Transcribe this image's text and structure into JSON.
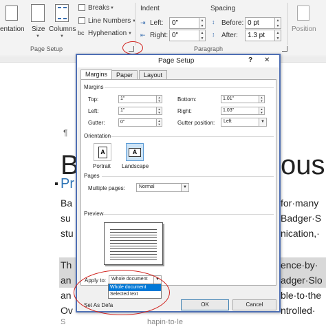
{
  "ribbon": {
    "orientation_label": "entation",
    "size_label": "Size",
    "columns_label": "Columns",
    "breaks_label": "Breaks",
    "line_numbers_label": "Line Numbers",
    "hyphenation_label": "Hyphenation",
    "page_setup_group": "Page Setup",
    "indent": {
      "title": "Indent",
      "left_label": "Left:",
      "left_value": "0\"",
      "right_label": "Right:",
      "right_value": "0\""
    },
    "spacing": {
      "title": "Spacing",
      "before_label": "Before:",
      "before_value": "0 pt",
      "after_label": "After:",
      "after_value": "1.3 pt"
    },
    "paragraph_group": "Paragraph",
    "position_label": "Position"
  },
  "document": {
    "pilcrow1": "¶",
    "heading_left": "B",
    "heading_right": "ous¶",
    "subheading": "Pr",
    "lines": [
      {
        "left": "Ba",
        "right": "for·many"
      },
      {
        "left": "su",
        "right": "Badger·S"
      },
      {
        "left": "stu",
        "right": "nication,·"
      },
      {
        "left": "Th",
        "right": "ence·by·"
      },
      {
        "left": "an",
        "right": "adger·Slo"
      },
      {
        "left": "an",
        "right": "ble·to·the"
      },
      {
        "left": "Ov",
        "right": "ntrolled·"
      },
      {
        "left": "S",
        "right": "hapin·to·le"
      }
    ]
  },
  "dialog": {
    "title": "Page Setup",
    "help": "?",
    "close": "✕",
    "tabs": [
      "Margins",
      "Paper",
      "Layout"
    ],
    "margins_section": "Margins",
    "top": {
      "label": "Top:",
      "value": "1\""
    },
    "bottom": {
      "label": "Bottom:",
      "value": "1.01\""
    },
    "left": {
      "label": "Left:",
      "value": "1\""
    },
    "right": {
      "label": "Right:",
      "value": "1.03\""
    },
    "gutter": {
      "label": "Gutter:",
      "value": "0\""
    },
    "gutter_position": {
      "label": "Gutter position:",
      "value": "Left"
    },
    "orientation_section": "Orientation",
    "portrait": "Portrait",
    "landscape": "Landscape",
    "pages_section": "Pages",
    "multiple_pages": {
      "label": "Multiple pages:",
      "value": "Normal"
    },
    "preview_section": "Preview",
    "apply_to": {
      "label": "Apply to:",
      "value": "Whole document",
      "options": [
        "Whole document",
        "Selected text"
      ]
    },
    "set_as_default": "Set As Defa",
    "ok": "OK",
    "cancel": "Cancel"
  },
  "colors": {
    "dialog_border": "#4e6fb4",
    "highlight_red": "#d0201b",
    "subheading_blue": "#2e74b5",
    "selection_blue": "#0078d7"
  }
}
